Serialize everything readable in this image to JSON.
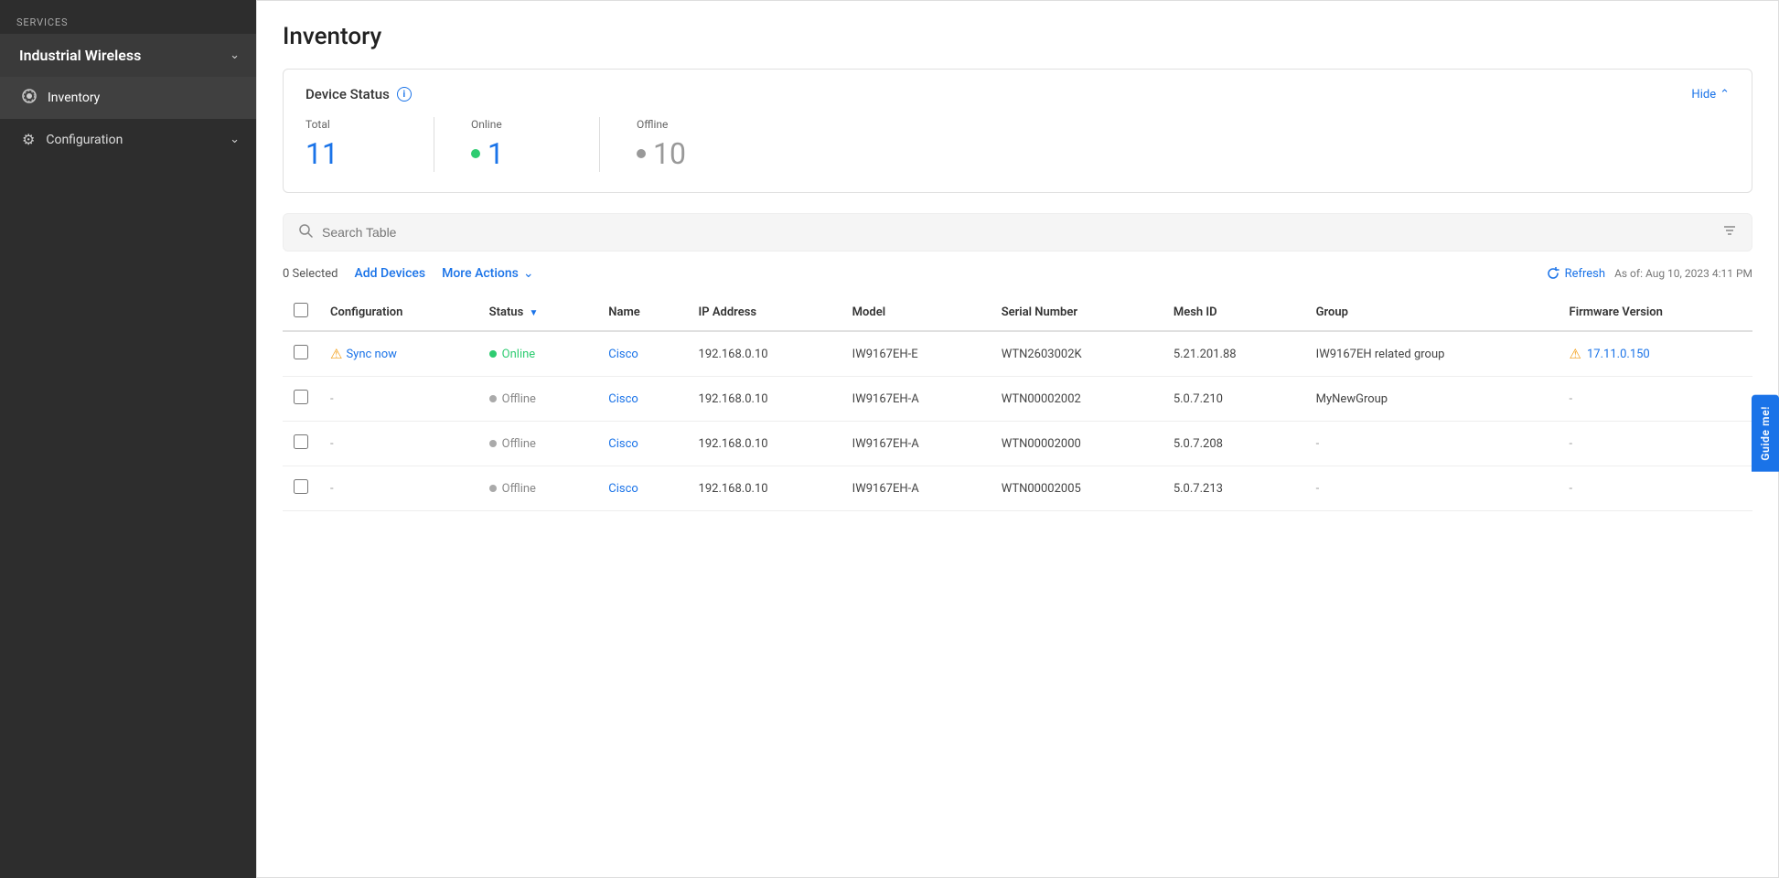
{
  "sidebar": {
    "services_label": "SERVICES",
    "service_name": "Industrial Wireless",
    "nav_items": [
      {
        "id": "inventory",
        "label": "Inventory",
        "icon": "☰",
        "active": true
      },
      {
        "id": "configuration",
        "label": "Configuration",
        "icon": "⚙",
        "active": false,
        "has_chevron": true
      }
    ]
  },
  "page": {
    "title": "Inventory"
  },
  "device_status": {
    "section_title": "Device Status",
    "hide_label": "Hide",
    "total_label": "Total",
    "total_value": "11",
    "online_label": "Online",
    "online_value": "1",
    "offline_label": "Offline",
    "offline_value": "10"
  },
  "search": {
    "placeholder": "Search Table"
  },
  "toolbar": {
    "selected_label": "0 Selected",
    "add_devices_label": "Add Devices",
    "more_actions_label": "More Actions",
    "refresh_label": "Refresh",
    "timestamp": "As of: Aug 10, 2023 4:11 PM"
  },
  "table": {
    "columns": [
      {
        "id": "config",
        "label": "Configuration",
        "sortable": false
      },
      {
        "id": "status",
        "label": "Status",
        "sortable": true
      },
      {
        "id": "name",
        "label": "Name",
        "sortable": false
      },
      {
        "id": "ip",
        "label": "IP Address",
        "sortable": false
      },
      {
        "id": "model",
        "label": "Model",
        "sortable": false
      },
      {
        "id": "serial",
        "label": "Serial Number",
        "sortable": false
      },
      {
        "id": "mesh_id",
        "label": "Mesh ID",
        "sortable": false
      },
      {
        "id": "group",
        "label": "Group",
        "sortable": false
      },
      {
        "id": "firmware",
        "label": "Firmware Version",
        "sortable": false
      }
    ],
    "rows": [
      {
        "id": 1,
        "config": "Sync now",
        "config_warning": true,
        "status": "Online",
        "status_type": "online",
        "name": "Cisco",
        "ip": "192.168.0.10",
        "model": "IW9167EH-E",
        "serial": "WTN2603002K",
        "mesh_id": "5.21.201.88",
        "group": "IW9167EH related group",
        "firmware": "17.11.0.150",
        "firmware_warning": true
      },
      {
        "id": 2,
        "config": "-",
        "config_warning": false,
        "status": "Offline",
        "status_type": "offline",
        "name": "Cisco",
        "ip": "192.168.0.10",
        "model": "IW9167EH-A",
        "serial": "WTN00002002",
        "mesh_id": "5.0.7.210",
        "group": "MyNewGroup",
        "firmware": "-",
        "firmware_warning": false
      },
      {
        "id": 3,
        "config": "-",
        "config_warning": false,
        "status": "Offline",
        "status_type": "offline",
        "name": "Cisco",
        "ip": "192.168.0.10",
        "model": "IW9167EH-A",
        "serial": "WTN00002000",
        "mesh_id": "5.0.7.208",
        "group": "-",
        "firmware": "-",
        "firmware_warning": false
      },
      {
        "id": 4,
        "config": "-",
        "config_warning": false,
        "status": "Offline",
        "status_type": "offline",
        "name": "Cisco",
        "ip": "192.168.0.10",
        "model": "IW9167EH-A",
        "serial": "WTN00002005",
        "mesh_id": "5.0.7.213",
        "group": "-",
        "firmware": "-",
        "firmware_warning": false
      }
    ]
  },
  "guide_me": {
    "label": "Guide me!"
  },
  "colors": {
    "accent": "#1a73e8",
    "online": "#2ecc71",
    "offline": "#aaaaaa",
    "warning": "#f39c12",
    "sidebar_bg": "#2d2d2d",
    "sidebar_active": "#404040"
  }
}
